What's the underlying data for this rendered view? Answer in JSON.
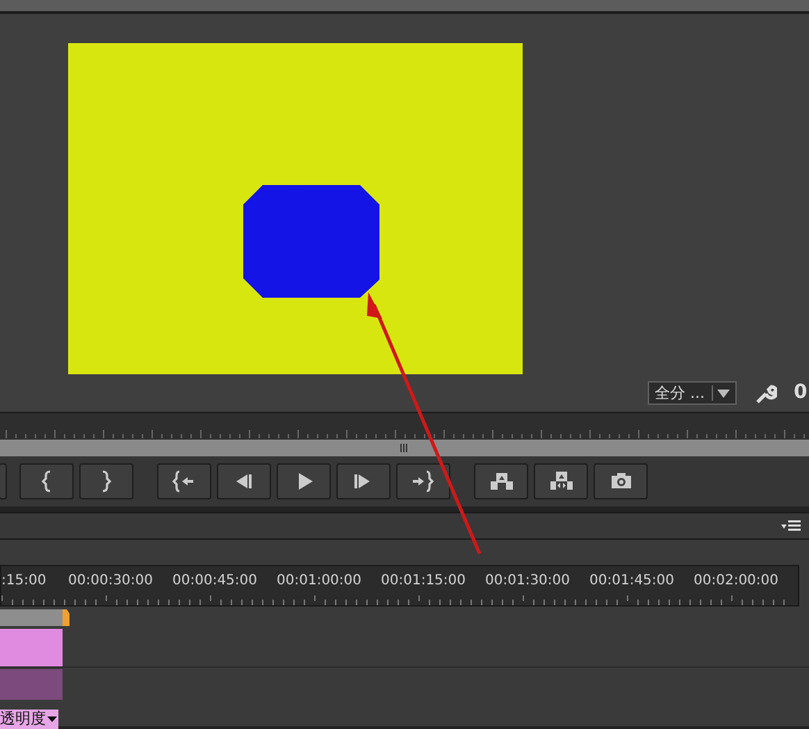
{
  "monitor": {
    "zoom_dropdown": {
      "value": "全分 ..."
    },
    "timecode": "0"
  },
  "transport": [
    {
      "kind": "partial"
    },
    {
      "kind": "mark-in"
    },
    {
      "kind": "mark-out"
    },
    {
      "kind": "go-in"
    },
    {
      "kind": "step-back"
    },
    {
      "kind": "play"
    },
    {
      "kind": "step-forward"
    },
    {
      "kind": "go-out"
    },
    {
      "kind": "lift"
    },
    {
      "kind": "extract"
    },
    {
      "kind": "camera"
    }
  ],
  "timeline": {
    "ruler_labels": [
      ":15:00",
      "00:00:30:00",
      "00:00:45:00",
      "00:01:00:00",
      "00:01:15:00",
      "00:01:30:00",
      "00:01:45:00",
      "00:02:00:00"
    ],
    "clip_label": "透明度"
  }
}
